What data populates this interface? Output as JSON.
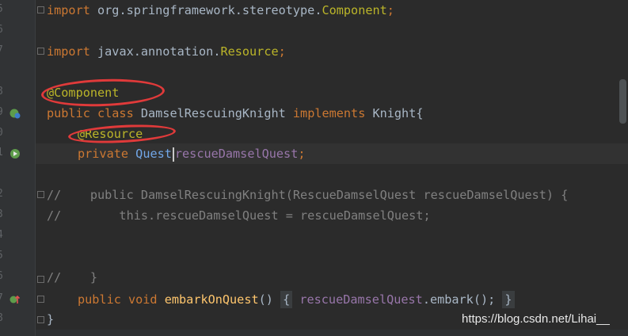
{
  "gutter": {
    "line_numbers": [
      "5",
      "6",
      "7",
      "8",
      "9",
      "0",
      "1",
      "2",
      "3",
      "4",
      "5",
      "6",
      "7",
      "8"
    ]
  },
  "code": {
    "l1": {
      "kw": "import",
      "rest": " org.springframework.stereotype.",
      "cls": "Component",
      "end": ";"
    },
    "l2": {
      "kw": "import",
      "rest": " javax.annotation.",
      "cls": "Resource",
      "end": ";"
    },
    "l3": {
      "ann": "@Component"
    },
    "l4": {
      "kw1": "public class",
      "name": " DamselRescuingKnight ",
      "kw2": "implements",
      "rest": " Knight{"
    },
    "l5": {
      "ann": "@Resource"
    },
    "l6": {
      "kw": "private",
      "type": "Quest",
      "field": "rescueDamselQuest",
      "end": ";"
    },
    "l7": {
      "text": "//    public DamselRescuingKnight(RescueDamselQuest rescueDamselQuest) {"
    },
    "l8": {
      "text": "//        this.rescueDamselQuest = rescueDamselQuest;"
    },
    "l9": {
      "text": "//    }"
    },
    "l10": {
      "kw": "public void",
      "fn": "embarkOnQuest",
      "paren": "() ",
      "ob": "{",
      "field": " rescueDamselQuest",
      "call": ".embark();",
      "cb": "}"
    },
    "l11": {
      "text": "}"
    }
  },
  "watermark": "https://blog.csdn.net/Lihai__",
  "colors": {
    "background": "#2b2b2b",
    "keyword": "#cc7832",
    "annotation": "#bbb529",
    "comment": "#808080",
    "field": "#9876aa",
    "method": "#ffc66d",
    "highlight_ellipse": "#e03a3a"
  },
  "icons": {
    "spring_bean": "spring-bean-icon",
    "autowired": "autowired-icon",
    "override": "override-icon"
  }
}
